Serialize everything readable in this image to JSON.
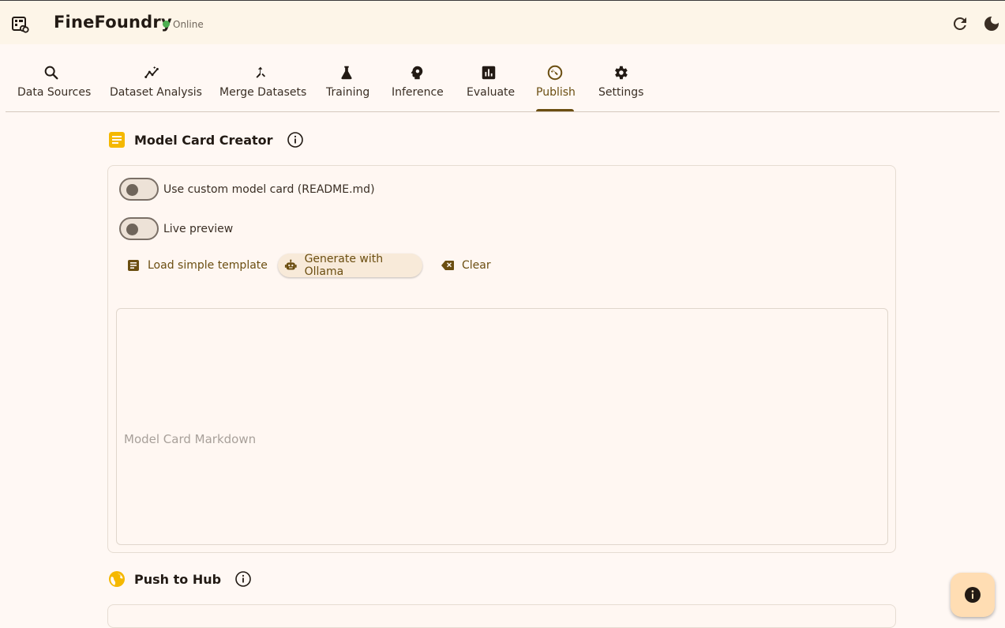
{
  "app": {
    "title": "FineFoundry",
    "status": "Online"
  },
  "colors": {
    "accent": "#6b4e11",
    "status_online": "#4caf50",
    "background": "#fff8f4",
    "appbar": "#fdf5e8",
    "fab": "#ffddb3",
    "section_icon_yellow": "#f5b800"
  },
  "header_actions": [
    {
      "icon": "refresh-icon"
    },
    {
      "icon": "dark-mode-icon"
    }
  ],
  "tabs": [
    {
      "label": "Data Sources",
      "icon": "search-icon"
    },
    {
      "label": "Dataset Analysis",
      "icon": "insights-icon"
    },
    {
      "label": "Merge Datasets",
      "icon": "merge-icon"
    },
    {
      "label": "Training",
      "icon": "flask-icon"
    },
    {
      "label": "Inference",
      "icon": "psychology-icon"
    },
    {
      "label": "Evaluate",
      "icon": "bar-chart-icon"
    },
    {
      "label": "Publish",
      "icon": "publish-icon",
      "active": true
    },
    {
      "label": "Settings",
      "icon": "gear-icon"
    }
  ],
  "model_card": {
    "title": "Model Card Creator",
    "use_custom_label": "Use custom model card (README.md)",
    "use_custom_on": false,
    "live_preview_label": "Live preview",
    "live_preview_on": false,
    "buttons": {
      "load_template": "Load simple template",
      "generate": "Generate with Ollama",
      "clear": "Clear"
    },
    "editor_placeholder": "Model Card Markdown",
    "editor_value": ""
  },
  "push_to_hub": {
    "title": "Push to Hub"
  }
}
